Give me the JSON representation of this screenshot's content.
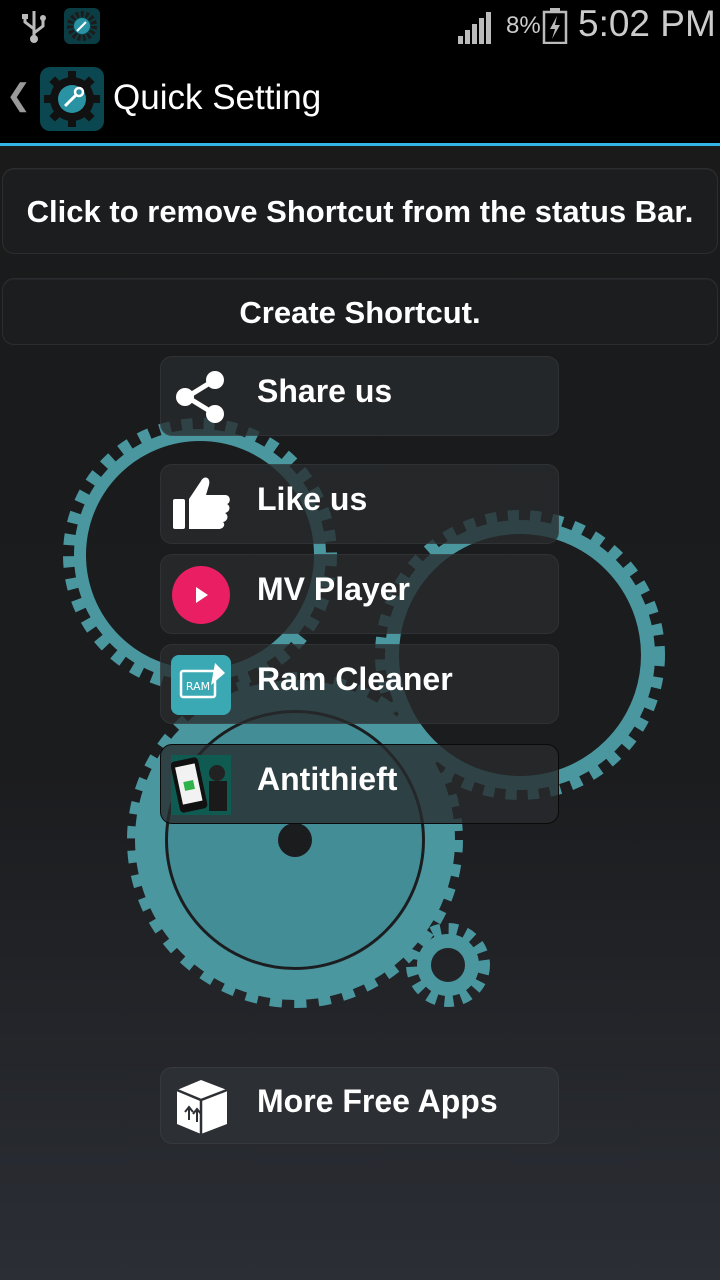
{
  "status_bar": {
    "battery_percent": "8%",
    "time": "5:02 PM",
    "icons": [
      "usb-icon",
      "app-notification-icon",
      "signal-icon",
      "battery-charging-icon"
    ]
  },
  "action_bar": {
    "title": "Quick Setting",
    "icons": [
      "back-chevron-icon",
      "app-gear-icon"
    ]
  },
  "buttons": {
    "remove_shortcut": "Click to remove Shortcut from the status Bar.",
    "create_shortcut": "Create Shortcut."
  },
  "menu": [
    {
      "label": "Share us",
      "icon": "share-icon"
    },
    {
      "label": "Like us",
      "icon": "thumbs-up-icon"
    },
    {
      "label": "MV Player",
      "icon": "play-icon"
    },
    {
      "label": "Ram Cleaner",
      "icon": "ram-cleaner-icon"
    },
    {
      "label": "Antithieft",
      "icon": "antitheft-icon"
    }
  ],
  "more_apps": {
    "label": "More Free Apps",
    "icon": "box-icon"
  },
  "colors": {
    "accent_line": "#33b5e5",
    "gear_teal": "#4a97a0",
    "play_red": "#e91e63"
  }
}
